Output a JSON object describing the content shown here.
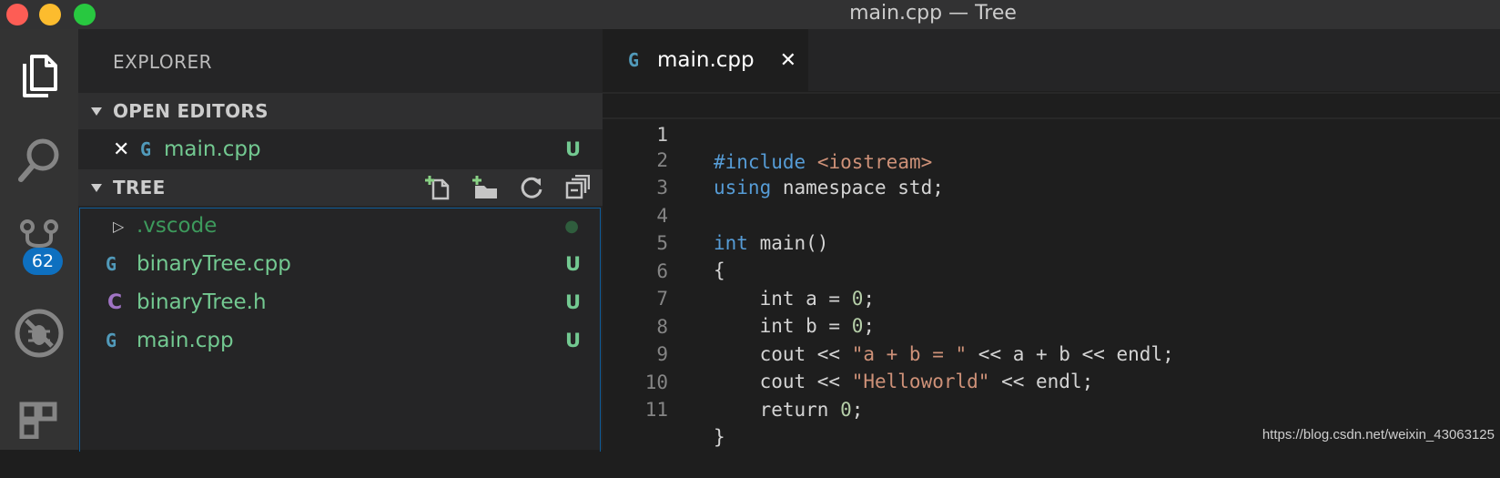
{
  "window": {
    "title": "main.cpp — Tree",
    "colors": {
      "close": "#fd5d55",
      "minimize": "#fcbc2e",
      "maximize": "#28c840"
    }
  },
  "activity_bar": {
    "icons": [
      "explorer-icon",
      "search-icon",
      "source-control-icon",
      "debug-icon",
      "extensions-icon"
    ],
    "scm_badge": "62"
  },
  "sidebar": {
    "title": "EXPLORER",
    "open_editors": {
      "label": "OPEN EDITORS",
      "items": [
        {
          "name": "main.cpp",
          "status": "U",
          "icon": "cpp-icon"
        }
      ]
    },
    "tree": {
      "label": "TREE",
      "actions": [
        "new-file-icon",
        "new-folder-icon",
        "refresh-icon",
        "collapse-all-icon"
      ],
      "items": [
        {
          "name": ".vscode",
          "type": "folder",
          "status": "●"
        },
        {
          "name": "binaryTree.cpp",
          "type": "cpp",
          "status": "U"
        },
        {
          "name": "binaryTree.h",
          "type": "h",
          "status": "U"
        },
        {
          "name": "main.cpp",
          "type": "cpp",
          "status": "U"
        }
      ]
    }
  },
  "editor": {
    "tab": {
      "label": "main.cpp",
      "close": "✕",
      "icon": "cpp-icon"
    },
    "lines": [
      {
        "n": "1",
        "text": "#include <iostream>"
      },
      {
        "n": "2",
        "text": "using namespace std;"
      },
      {
        "n": "3",
        "text": ""
      },
      {
        "n": "4",
        "text": "int main()"
      },
      {
        "n": "5",
        "text": "{"
      },
      {
        "n": "6",
        "text": "    int a = 0;"
      },
      {
        "n": "7",
        "text": "    int b = 0;"
      },
      {
        "n": "8",
        "text": "    cout << \"a + b = \" << a + b << endl;"
      },
      {
        "n": "9",
        "text": "    cout << \"Helloworld\" << endl;"
      },
      {
        "n": "10",
        "text": "    return 0;"
      },
      {
        "n": "11",
        "text": "}"
      }
    ]
  },
  "watermark": "https://blog.csdn.net/weixin_43063125"
}
